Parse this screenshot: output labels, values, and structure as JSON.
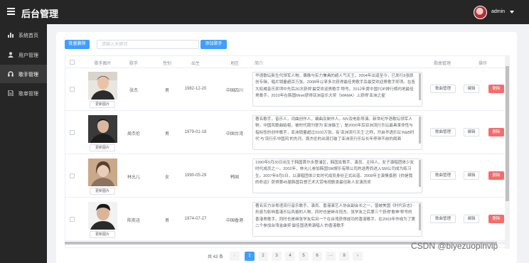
{
  "app": {
    "title": "后台管理",
    "user_name": "admin"
  },
  "sidebar": {
    "items": [
      {
        "label": "系统首页",
        "icon": "bar-chart-icon"
      },
      {
        "label": "用户管理",
        "icon": "user-icon"
      },
      {
        "label": "歌手管理",
        "icon": "headphones-icon"
      },
      {
        "label": "歌单管理",
        "icon": "document-icon"
      }
    ],
    "active": "歌手管理"
  },
  "toolbar": {
    "batch_delete": "批量删除",
    "search_placeholder": "请输入关键词",
    "add_singer": "添加歌手"
  },
  "table": {
    "headers": [
      "歌手图片",
      "歌手",
      "性别",
      "出生",
      "地区",
      "简介",
      "歌曲管理",
      "操作"
    ],
    "update_photo_label": "更新图片",
    "song_manage_label": "歌曲管理",
    "edit_label": "编辑",
    "delete_label": "删除",
    "rows": [
      {
        "name": "张杰",
        "sex": "男",
        "birth": "1982-12-20",
        "region": "中国四川",
        "intro": "华语歌坛新生代领军人物，偶像与实力兼具的超人气天王。2004年出道至今，已发行9张原创专辑，唱片销量超百万张。2008年以来多次获得最佳男歌手及最受欢迎男歌手奖项。在各大权威音乐奖项中先后20次获得‘最受欢迎男歌手’称号。2012年度中国TOP排行榜内地最佳男歌手。2010年在韩国Mnet获得亚洲音乐大奖（MAMA）上获得‘亚洲之星’"
      },
      {
        "name": "周杰伦",
        "sex": "男",
        "birth": "1979-01-18",
        "region": "中国台湾",
        "intro": "著名歌手，音乐人，词曲创作人，编曲及制作人，MV及电影导演。新世纪华语歌坛领军人物，中国风歌曲始祖，被时代周刊誉为‘亚洲猫王’，是2000年后亚洲流行乐坛最具革命性与指标性的创作歌手，亚洲销量超过3100万张，有‘亚洲流行天王’之称，开启华语乐坛‘R&B时代’与‘流行乐中国风’的先河，周杰伦的出现打破了亚洲流行乐坛长年停滞不前的局面"
      },
      {
        "name": "林允儿",
        "sex": "女",
        "birth": "1990-05-29",
        "region": "韩国",
        "intro": "1990年5月30日出生于韩国首尔永登浦区，韩国女歌手、演员、主持人，女子演唱团体少女时代成员之一。2002年，林允儿参加韩国SM娱乐有限公司的选秀而进入SM公司成为练习生。2007年8月5日，以演唱团体少女时代成员身份正式出道。2008年主演情景剧《你是我的命运》获得第45届韩国百想艺术大赏电视剧类最佳新人女演员奖"
      },
      {
        "name": "陈奕迅",
        "sex": "男",
        "birth": "1974-07-27",
        "region": "中国香港",
        "intro": "著名实力派粤语流行音乐歌手、演员、香港演艺人协会副会长之一，曾被美国《时代杂志》形容为影响香港乐坛风格的人物，同时也是继许冠杰、张学友之后第三个获得‘歌神’称号的香港男歌手。同时也是继张学友后另一个在台湾获得成功的香港歌手，在2003年作成为了第二个参加台湾金曲奖‘最佳国语男演唱人’的香港歌手"
      }
    ]
  },
  "pagination": {
    "total": "共 43 条",
    "pages": [
      "1",
      "2",
      "3",
      "4",
      "5",
      "6",
      "···",
      "9"
    ],
    "current": "1",
    "prev": "‹",
    "next": "›"
  },
  "watermark": "CSDN @biyezuopinvip"
}
